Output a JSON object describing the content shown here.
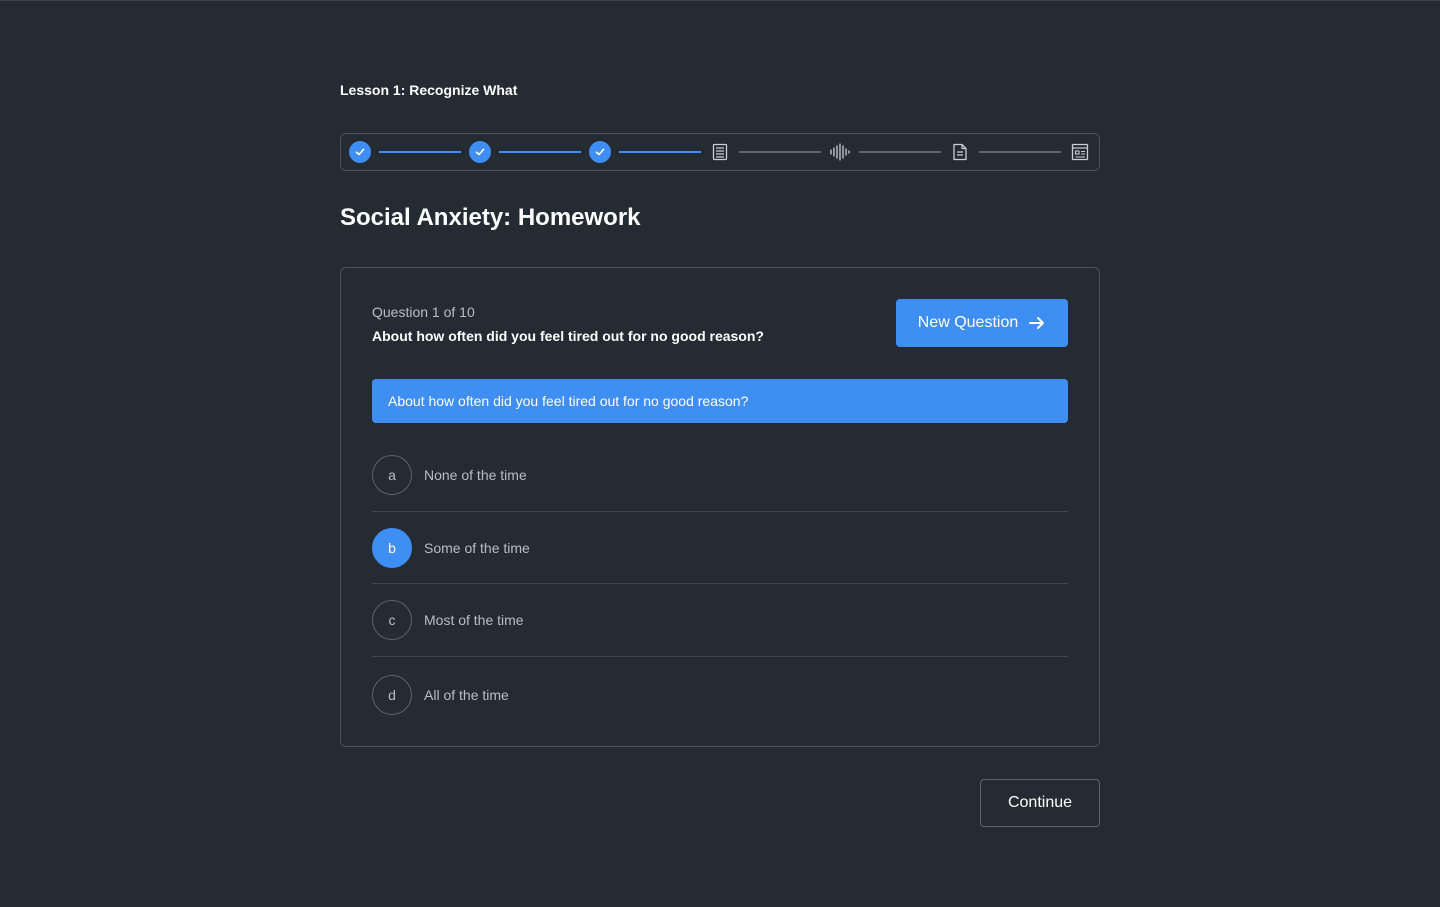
{
  "lesson": {
    "title": "Lesson 1: Recognize What"
  },
  "stepper": {
    "steps": [
      {
        "icon": "check-icon",
        "status": "done"
      },
      {
        "icon": "check-icon",
        "status": "done"
      },
      {
        "icon": "check-icon",
        "status": "done"
      },
      {
        "icon": "document-lines-icon",
        "status": "pending"
      },
      {
        "icon": "audio-waveform-icon",
        "status": "pending"
      },
      {
        "icon": "file-text-icon",
        "status": "pending"
      },
      {
        "icon": "form-icon",
        "status": "pending"
      }
    ],
    "accent": "#3e8ef4"
  },
  "heading": "Social Anxiety: Homework",
  "question": {
    "counter": "Question 1 of 10",
    "text": "About how often did you feel tired out for no good reason?",
    "prompt": "About how often did you feel tired out for no good reason?",
    "new_question_label": "New Question",
    "options": [
      {
        "letter": "a",
        "label": "None of the time",
        "selected": false
      },
      {
        "letter": "b",
        "label": "Some of the time",
        "selected": true
      },
      {
        "letter": "c",
        "label": "Most of the time",
        "selected": false
      },
      {
        "letter": "d",
        "label": "All of the time",
        "selected": false
      }
    ]
  },
  "footer": {
    "continue_label": "Continue"
  },
  "colors": {
    "background": "#242b33",
    "accent": "#3e8ef4",
    "border": "#4a535d"
  }
}
